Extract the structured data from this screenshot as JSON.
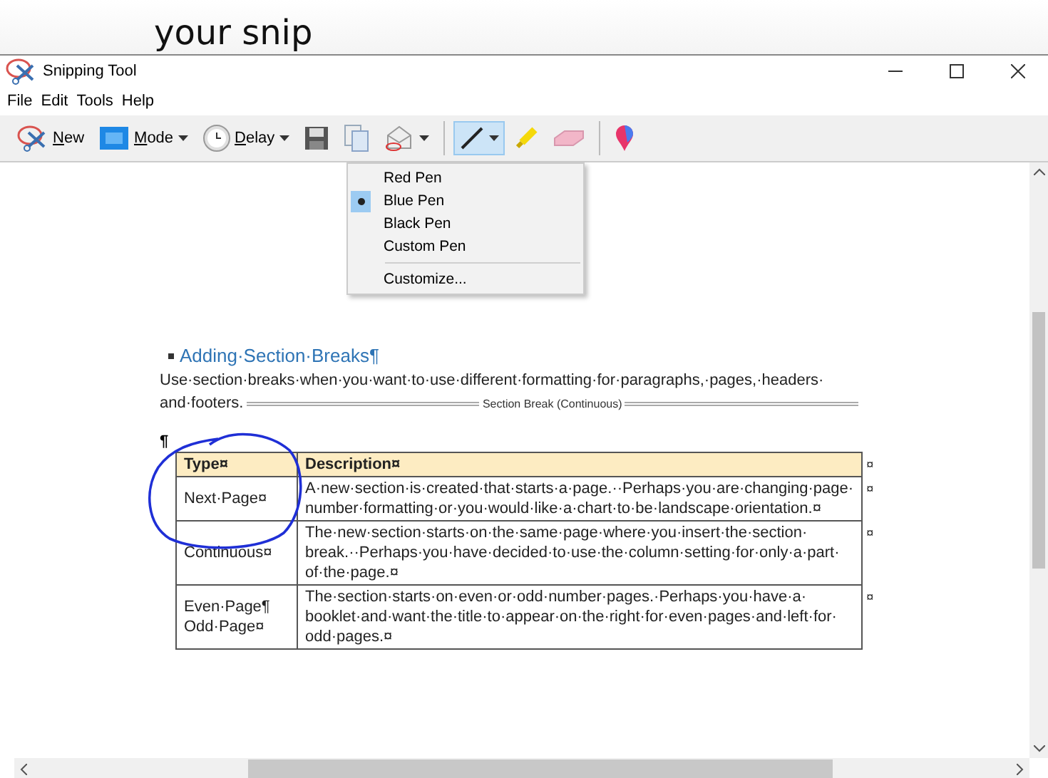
{
  "banner": {
    "text": "your snip"
  },
  "window": {
    "title": "Snipping Tool"
  },
  "menu_bar": [
    "File",
    "Edit",
    "Tools",
    "Help"
  ],
  "toolbar": [
    {
      "kind": "new",
      "label": "New",
      "dropdown": false,
      "pressed": false
    },
    {
      "kind": "mode",
      "label": "Mode",
      "dropdown": true,
      "pressed": false
    },
    {
      "kind": "delay",
      "label": "Delay",
      "dropdown": true,
      "pressed": false
    },
    {
      "kind": "save",
      "dropdown": false,
      "pressed": false
    },
    {
      "kind": "copy",
      "dropdown": false,
      "pressed": false
    },
    {
      "kind": "email",
      "dropdown": true,
      "pressed": false
    },
    {
      "kind": "separator"
    },
    {
      "kind": "pen",
      "dropdown": true,
      "pressed": true
    },
    {
      "kind": "highlighter",
      "dropdown": false,
      "pressed": false
    },
    {
      "kind": "eraser",
      "dropdown": false,
      "pressed": false
    },
    {
      "kind": "separator"
    },
    {
      "kind": "paint",
      "dropdown": false,
      "pressed": false
    }
  ],
  "pen_menu": [
    {
      "kind": "pen",
      "label": "Red Pen",
      "selected": false
    },
    {
      "kind": "pen",
      "label": "Blue Pen",
      "selected": true
    },
    {
      "kind": "pen",
      "label": "Black Pen",
      "selected": false
    },
    {
      "kind": "pen",
      "label": "Custom Pen",
      "selected": false
    },
    {
      "kind": "command",
      "label": "Customize..."
    }
  ],
  "document": {
    "heading": "Adding·Section·Breaks¶",
    "paragraph_lines": [
      "Use·section·breaks·when·you·want·to·use·different·formatting·for·paragraphs,·pages,·headers·",
      "and·footers."
    ],
    "section_break": "Section Break (Continuous)",
    "empty_paragraph": "¶",
    "table": {
      "columns": [
        "Type¤",
        "Description¤"
      ],
      "header_end_mark": "¤",
      "rows": [
        {
          "type_lines": [
            "Next·Page¤"
          ],
          "description_lines": [
            "A·new·section·is·created·that·starts·a·page.··Perhaps·you·are·changing·page·",
            "number·formatting·or·you·would·like·a·chart·to·be·landscape·orientation.¤"
          ],
          "end_mark": "¤"
        },
        {
          "type_lines": [
            "Continuous¤"
          ],
          "description_lines": [
            "The·new·section·starts·on·the·same·page·where·you·insert·the·section·",
            "break.··Perhaps·you·have·decided·to·use·the·column·setting·for·only·a·part·",
            "of·the·page.¤"
          ],
          "end_mark": "¤"
        },
        {
          "type_lines": [
            "Even·Page¶",
            "Odd·Page¤"
          ],
          "description_lines": [
            "The·section·starts·on·even·or·odd·number·pages.·Perhaps·you·have·a·",
            "booklet·and·want·the·title·to·appear·on·the·right·for·even·pages·and·left·for·",
            "odd·pages.¤"
          ],
          "end_mark": "¤"
        }
      ]
    }
  }
}
